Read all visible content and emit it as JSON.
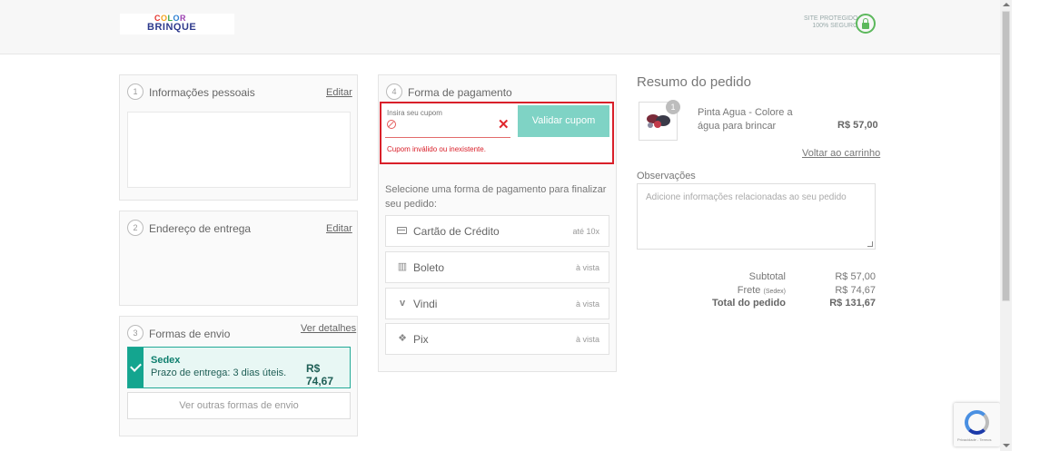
{
  "header": {
    "logo": {
      "line1": "COLOR",
      "line2": "BRINQUE"
    },
    "secure": {
      "line1": "SITE PROTEGIDO",
      "line2": "100% SEGURO"
    }
  },
  "personal": {
    "step": "1",
    "title": "Informações pessoais",
    "edit": "Editar"
  },
  "address": {
    "step": "2",
    "title": "Endereço de entrega",
    "edit": "Editar"
  },
  "shipping": {
    "step": "3",
    "title": "Formas de envio",
    "details": "Ver detalhes",
    "selected": {
      "name": "Sedex",
      "desc": "Prazo de entrega: 3 dias úteis.",
      "price": "R$ 74,67"
    },
    "other": "Ver outras formas de envio"
  },
  "payment": {
    "step": "4",
    "title": "Forma de pagamento",
    "coupon": {
      "label": "Insira seu cupom",
      "button": "Validar cupom",
      "error": "Cupom inválido ou inexistente."
    },
    "instruction": "Selecione uma forma de pagamento para finalizar seu pedido:",
    "options": [
      {
        "icon": "credit-card-icon",
        "name": "Cartão de Crédito",
        "note": "até 10x"
      },
      {
        "icon": "barcode-icon",
        "name": "Boleto",
        "note": "à vista"
      },
      {
        "icon": "vindi-icon",
        "name": "Vindi",
        "note": "à vista"
      },
      {
        "icon": "pix-icon",
        "name": "Pix",
        "note": "à vista"
      }
    ]
  },
  "summary": {
    "title": "Resumo do pedido",
    "product": {
      "qty": "1",
      "name": "Pinta Agua - Colore a água para brincar",
      "price": "R$ 57,00"
    },
    "back": "Voltar ao carrinho",
    "obs_label": "Observações",
    "obs_placeholder": "Adicione informações relacionadas ao seu pedido",
    "subtotal_label": "Subtotal",
    "subtotal": "R$ 57,00",
    "frete_label": "Frete",
    "frete_note": "(Sedex)",
    "frete": "R$ 74,67",
    "total_label": "Total do pedido",
    "total": "R$ 131,67"
  },
  "recaptcha": {
    "text": "Privacidade - Termos"
  },
  "colors": {
    "accent": "#14a58f",
    "button": "#7fd3c5",
    "error": "#d9202a"
  }
}
